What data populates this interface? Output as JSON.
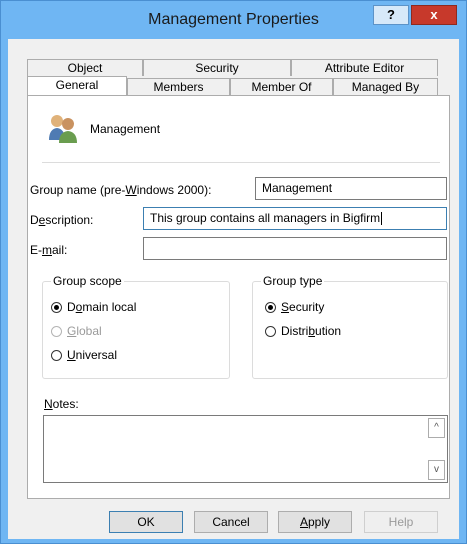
{
  "window": {
    "title": "Management Properties",
    "help_glyph": "?",
    "close_glyph": "x"
  },
  "tabs_row1": [
    {
      "label": "Object"
    },
    {
      "label": "Security"
    },
    {
      "label": "Attribute Editor"
    }
  ],
  "tabs_row2": [
    {
      "label": "General"
    },
    {
      "label": "Members"
    },
    {
      "label": "Member Of"
    },
    {
      "label": "Managed By"
    }
  ],
  "general": {
    "object_name": "Management",
    "group_name_label": "Group name (pre-Windows 2000):",
    "group_name_value": "Management",
    "description_label": "Description:",
    "description_value": "This group contains all managers in Bigfirm",
    "email_label": "E-mail:",
    "email_value": "",
    "group_scope": {
      "title": "Group scope",
      "options": [
        {
          "label": "Domain local",
          "checked": true
        },
        {
          "label": "Global",
          "disabled": true
        },
        {
          "label": "Universal"
        }
      ]
    },
    "group_type": {
      "title": "Group type",
      "options": [
        {
          "label": "Security",
          "checked": true
        },
        {
          "label": "Distribution"
        }
      ]
    },
    "notes_label": "Notes:",
    "notes_value": ""
  },
  "buttons": {
    "ok": "OK",
    "cancel": "Cancel",
    "apply": "Apply",
    "help": "Help"
  },
  "icons": {
    "scroll_up": "^",
    "scroll_down": "v"
  }
}
